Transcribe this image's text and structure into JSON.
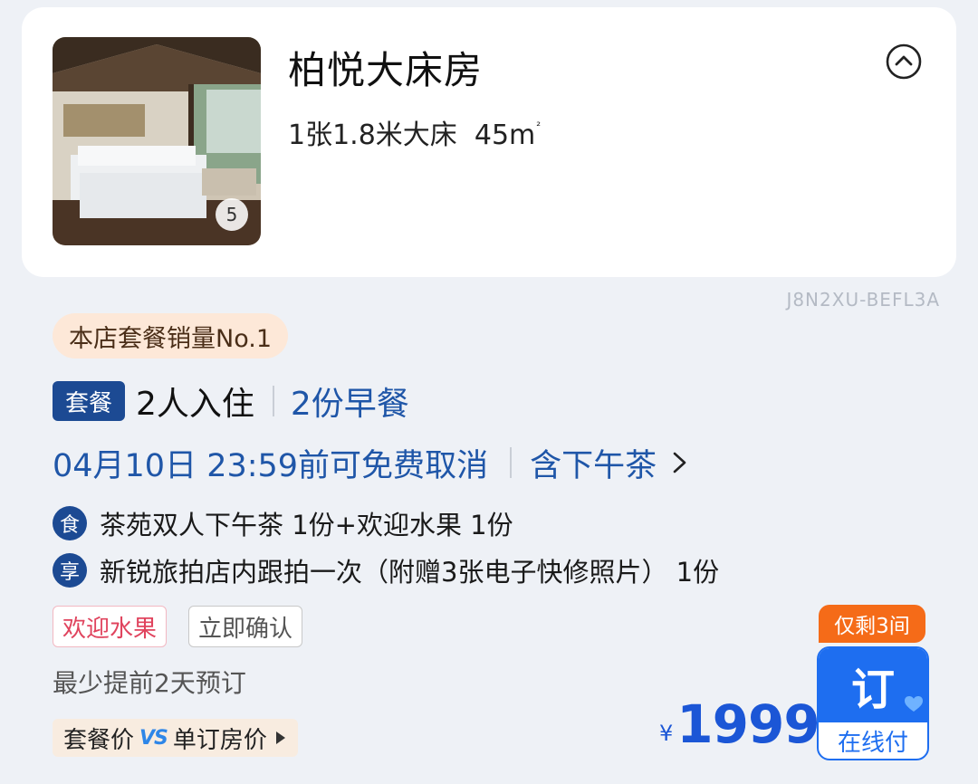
{
  "room": {
    "name": "柏悦大床房",
    "bed": "1张1.8米大床",
    "area": "45m",
    "area_unit": "²",
    "photo_count": "5"
  },
  "code": "J8N2XU-BEFL3A",
  "rank_badge": "本店套餐销量No.1",
  "package": {
    "tag": "套餐",
    "guests": "2人入住",
    "breakfast": "2份早餐",
    "cancel": "04月10日 23:59前可免费取消",
    "afternoon_tea": "含下午茶"
  },
  "perks": [
    {
      "icon": "食",
      "text": "茶苑双人下午茶 1份+欢迎水果 1份"
    },
    {
      "icon": "享",
      "text": "新锐旅拍店内跟拍一次（附赠3张电子快修照片） 1份"
    }
  ],
  "chips": [
    "欢迎水果",
    "立即确认"
  ],
  "advance_booking": "最少提前2天预订",
  "price_compare": {
    "left": "套餐价",
    "vs": "VS",
    "right": "单订房价"
  },
  "price": {
    "currency": "¥",
    "amount": "1999"
  },
  "rooms_left": "仅剩3间",
  "book": {
    "label": "订",
    "pay": "在线付"
  },
  "colors": {
    "accent": "#1f56a8",
    "book": "#1e6ef0",
    "badge": "#f56b18"
  }
}
